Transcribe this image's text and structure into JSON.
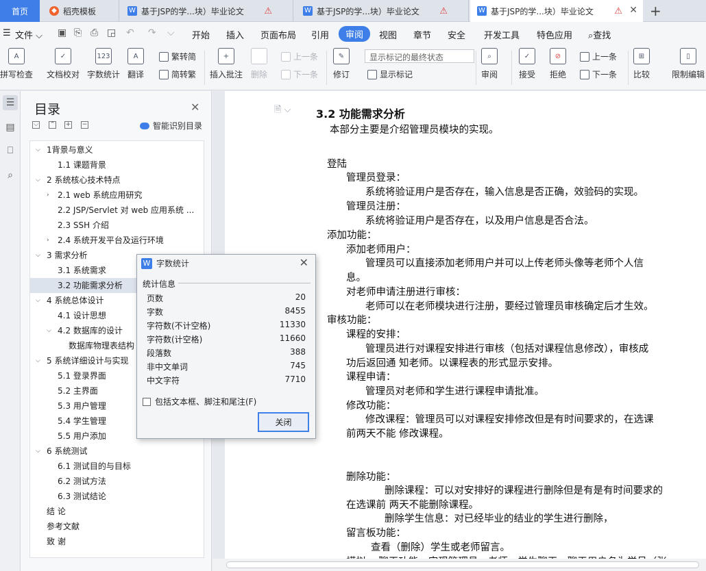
{
  "tabs": {
    "home": "首页",
    "t1": "稻壳模板",
    "t2": "基于JSP的学...块）毕业论文",
    "t3": "基于JSP的学...块）毕业论文",
    "t4": "基于JSP的学...块）毕业论文",
    "new": "+"
  },
  "menu": {
    "file": "文件",
    "items": [
      "开始",
      "插入",
      "页面布局",
      "引用",
      "审阅",
      "视图",
      "章节",
      "安全",
      "开发工具",
      "特色应用",
      "查找"
    ],
    "active": "审阅"
  },
  "ribbon": {
    "spellcheck": "拼写检查",
    "doccheck": "文档校对",
    "wordcount": "字数统计",
    "translate": "翻译",
    "to_trad": "繁转简",
    "to_simp": "简转繁",
    "insert_comment": "插入批注",
    "delete": "删除",
    "prev": "上一条",
    "next": "下一条",
    "revise": "修订",
    "markup_state": "显示标记的最终状态",
    "show_markup": "显示标记",
    "review": "审阅",
    "accept": "接受",
    "reject": "拒绝",
    "prev2": "上一条",
    "next2": "下一条",
    "compare": "比较",
    "restrict": "限制编辑"
  },
  "toc": {
    "title": "目录",
    "smart": "智能识别目录",
    "items": [
      {
        "text": "1背景与意义",
        "arrow": "v"
      },
      {
        "text": "1.1  课题背景",
        "arrow": ""
      },
      {
        "text": "2   系统核心技术特点",
        "arrow": "v"
      },
      {
        "text": "2.1   web 系统应用研究",
        "arrow": ">"
      },
      {
        "text": "2.2   JSP/Servlet 对 web 应用系统 ...",
        "arrow": ""
      },
      {
        "text": "2.3   SSH 介绍",
        "arrow": ""
      },
      {
        "text": "2.4   系统开发平台及运行环境",
        "arrow": ">"
      },
      {
        "text": "3 需求分析",
        "arrow": "v"
      },
      {
        "text": "3.1 系统需求",
        "arrow": ""
      },
      {
        "text": "3.2 功能需求分析",
        "arrow": ""
      },
      {
        "text": "4 系统总体设计",
        "arrow": "v"
      },
      {
        "text": "4.1 设计思想",
        "arrow": ""
      },
      {
        "text": "4.2 数据库的设计",
        "arrow": "v"
      },
      {
        "text": "数据库物理表结构",
        "arrow": ""
      },
      {
        "text": "5 系统详细设计与实现",
        "arrow": "v"
      },
      {
        "text": "5.1  登录界面",
        "arrow": ""
      },
      {
        "text": "5.2  主界面",
        "arrow": ""
      },
      {
        "text": "5.3  用户管理",
        "arrow": ""
      },
      {
        "text": "5.4  学生管理",
        "arrow": ""
      },
      {
        "text": "5.5  用户添加",
        "arrow": ""
      },
      {
        "text": "6 系统测试",
        "arrow": "v"
      },
      {
        "text": "6.1   测试目的与目标",
        "arrow": ""
      },
      {
        "text": "6.2   测试方法",
        "arrow": ""
      },
      {
        "text": "6.3  测试结论",
        "arrow": ""
      },
      {
        "text": "结     论",
        "arrow": ""
      },
      {
        "text": "参考文献",
        "arrow": ""
      },
      {
        "text": "致     谢",
        "arrow": ""
      }
    ]
  },
  "doc": {
    "lines": [
      "3.2 功能需求分析",
      "本部分主要是介绍管理员模块的实现。",
      "登陆",
      "管理员登录：",
      "系统将验证用户是否存在，输入信息是否正确，效验码的实现。",
      "管理员注册：",
      "系统将验证用户是否存在，以及用户信息是否合法。",
      "添加功能：",
      "添加老师用户：",
      "管理员可以直接添加老师用户并可以上传老师头像等老师个人信",
      "息。",
      "对老师申请注册进行审核：",
      "老师可以在老师模块进行注册，要经过管理员审核确定后才生效。",
      "审核功能：",
      "课程的安排：",
      "管理员进行对课程安排进行审核（包括对课程信息修改），审核成",
      "功后返回通 知老师。以课程表的形式显示安排。",
      "课程申请：",
      "管理员对老师和学生进行课程申请批准。",
      "修改功能：",
      "修改课程：管理员可以对课程安排修改但是有时间要求的，在选课",
      "前两天不能           修改课程。",
      "删除功能：",
      "删除课程：可以对安排好的课程进行删除但是有是有时间要求的",
      "在选课前                        两天不能删除课程。",
      "删除学生信息：对已经毕业的结业的学生进行删除，",
      "留言板功能：",
      "查看（删除）学生或老师留言。",
      "模拟qq聊天功能，实现管理员，老师，学生聊天，聊天用户名为学号（张"
    ]
  },
  "dialog": {
    "title": "字数统计",
    "group": "统计信息",
    "stats": [
      {
        "label": "页数",
        "value": "20"
      },
      {
        "label": "字数",
        "value": "8455"
      },
      {
        "label": "字符数(不计空格)",
        "value": "11330"
      },
      {
        "label": "字符数(计空格)",
        "value": "11660"
      },
      {
        "label": "段落数",
        "value": "388"
      },
      {
        "label": "非中文单词",
        "value": "745"
      },
      {
        "label": "中文字符",
        "value": "7710"
      }
    ],
    "checkbox": "包括文本框、脚注和尾注(F)",
    "close_button": "关闭"
  }
}
